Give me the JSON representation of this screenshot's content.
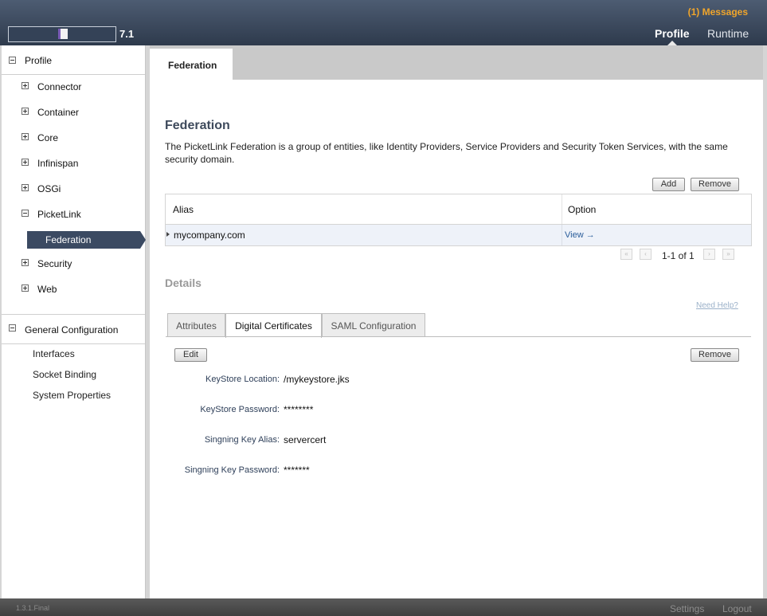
{
  "header": {
    "version": "7.1",
    "messages": "(1) Messages",
    "nav": {
      "profile": "Profile",
      "runtime": "Runtime"
    }
  },
  "sidebar": {
    "profile_title": "Profile",
    "items": [
      {
        "label": "Connector",
        "state": "collapsed"
      },
      {
        "label": "Container",
        "state": "collapsed"
      },
      {
        "label": "Core",
        "state": "collapsed"
      },
      {
        "label": "Infinispan",
        "state": "collapsed"
      },
      {
        "label": "OSGi",
        "state": "collapsed"
      },
      {
        "label": "PicketLink",
        "state": "expanded"
      },
      {
        "label": "Security",
        "state": "collapsed"
      },
      {
        "label": "Web",
        "state": "collapsed"
      }
    ],
    "selected_child": "Federation",
    "general_title": "General Configuration",
    "general_items": [
      "Interfaces",
      "Socket Binding",
      "System Properties"
    ]
  },
  "main": {
    "tab": "Federation",
    "title": "Federation",
    "description": "The PicketLink Federation is a group of entities, like Identity Providers, Service Providers and Security Token Services, with the same security domain.",
    "add_label": "Add",
    "remove_label": "Remove",
    "table": {
      "columns": [
        "Alias",
        "Option"
      ],
      "rows": [
        {
          "alias": "mycompany.com",
          "option": "View →"
        }
      ]
    },
    "pager": "1-1 of 1",
    "details_title": "Details",
    "need_help": "Need Help?",
    "subtabs": [
      "Attributes",
      "Digital Certificates",
      "SAML Configuration"
    ],
    "active_subtab": "Digital Certificates",
    "edit_label": "Edit",
    "details_remove_label": "Remove",
    "fields": [
      {
        "label": "KeyStore Location:",
        "value": "/mykeystore.jks"
      },
      {
        "label": "KeyStore Password:",
        "value": "********"
      },
      {
        "label": "Singning Key Alias:",
        "value": "servercert"
      },
      {
        "label": "Singning Key Password:",
        "value": "*******"
      }
    ]
  },
  "footer": {
    "version": "1.3.1.Final",
    "settings": "Settings",
    "logout": "Logout"
  }
}
